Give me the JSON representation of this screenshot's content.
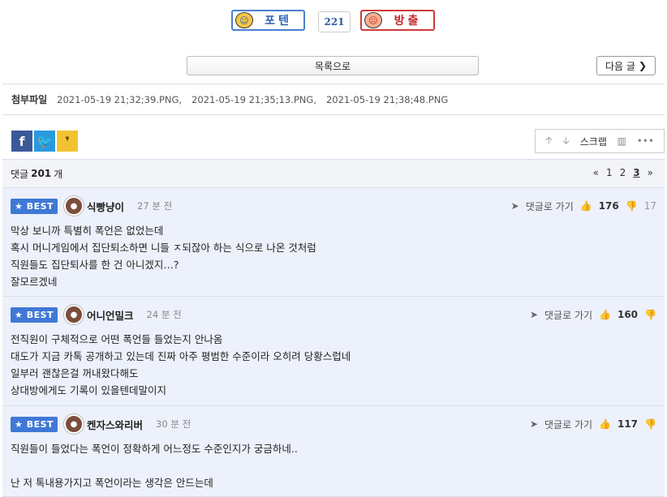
{
  "vote": {
    "up_label": "포텐",
    "count": "221",
    "down_label": "방출"
  },
  "nav": {
    "list_label": "목록으로",
    "next_label": "다음 글"
  },
  "attachments": {
    "label": "첨부파일",
    "files": [
      "2021-05-19 21;32;39.PNG,",
      "2021-05-19 21;35;13.PNG,",
      "2021-05-19 21;38;48.PNG"
    ]
  },
  "share": {
    "facebook": "f",
    "twitter": "t",
    "kakao": "k"
  },
  "tools": {
    "scrap_label": "스크랩"
  },
  "replies": {
    "label": "댓글",
    "count": "201",
    "unit": "개",
    "pages": [
      "1",
      "2",
      "3"
    ],
    "current_page": "3"
  },
  "comments": [
    {
      "badge": "BEST",
      "nick": "식빵냥이",
      "time": "27 분 전",
      "reply_label": "댓글로 가기",
      "up": "176",
      "down": "17",
      "lines": [
        "막상 보니까 특별히 폭언은 없었는데",
        "혹시 머니게임에서 집단퇴소하면 니들 ㅈ되잖아 하는 식으로 나온 것처럼",
        "직원들도 집단퇴사를 한 건 아니겠지…?",
        "잘모르겠네"
      ]
    },
    {
      "badge": "BEST",
      "nick": "어니언밀크",
      "time": "24 분 전",
      "reply_label": "댓글로 가기",
      "up": "160",
      "down": "",
      "lines": [
        "전직원이 구체적으로 어떤 폭언들 들었는지 안나옴",
        "대도가 지금 카톡 공개하고 있는데 진짜 아주 평범한 수준이라 오히려 당황스럽네",
        "일부러 괜찮은걸 꺼내왔다해도",
        "상대방에게도 기록이 있을텐데말이지"
      ]
    },
    {
      "badge": "BEST",
      "nick": "켄자스와리버",
      "time": "30 분 전",
      "reply_label": "댓글로 가기",
      "up": "117",
      "down": "",
      "lines": [
        "직원들이 들었다는 폭언이 정확하게 어느정도 수준인지가 궁금하네..",
        "",
        "난 저 톡내용가지고 폭언이라는 생각은 안드는데"
      ]
    }
  ]
}
